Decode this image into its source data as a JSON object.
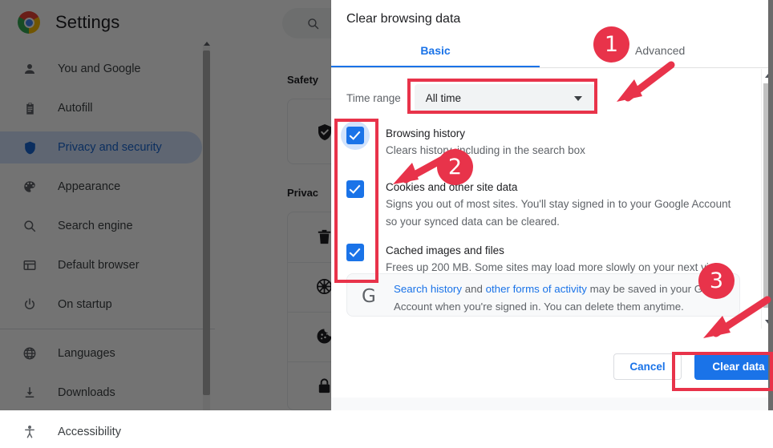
{
  "background": {
    "app_title": "Settings",
    "logo_icon": "chrome-logo-icon",
    "search_icon": "search-icon",
    "sidebar": {
      "items": [
        {
          "label": "You and Google",
          "icon": "person-icon",
          "selected": false
        },
        {
          "label": "Autofill",
          "icon": "clipboard-icon",
          "selected": false
        },
        {
          "label": "Privacy and security",
          "icon": "shield-icon",
          "selected": true
        },
        {
          "label": "Appearance",
          "icon": "palette-icon",
          "selected": false
        },
        {
          "label": "Search engine",
          "icon": "search-icon",
          "selected": false
        },
        {
          "label": "Default browser",
          "icon": "browser-window-icon",
          "selected": false
        },
        {
          "label": "On startup",
          "icon": "power-icon",
          "selected": false
        },
        {
          "label": "Languages",
          "icon": "globe-icon",
          "selected": false
        },
        {
          "label": "Downloads",
          "icon": "download-icon",
          "selected": false
        },
        {
          "label": "Accessibility",
          "icon": "accessibility-icon",
          "selected": false
        }
      ]
    },
    "sections": [
      {
        "heading": "Safety",
        "card_icons": [
          "shield-check-icon"
        ]
      },
      {
        "heading": "Privac",
        "card_icons": [
          "trash-icon",
          "privacy-guide-icon",
          "cookie-icon",
          "lock-icon"
        ]
      }
    ]
  },
  "dialog": {
    "title": "Clear browsing data",
    "tabs": [
      {
        "label": "Basic",
        "active": true
      },
      {
        "label": "Advanced",
        "active": false
      }
    ],
    "time_range": {
      "label": "Time range",
      "value": "All time",
      "caret_icon": "chevron-down-icon"
    },
    "options": [
      {
        "title": "Browsing history",
        "description": "Clears history, including in the search box",
        "checked": true,
        "focused": true
      },
      {
        "title": "Cookies and other site data",
        "description": "Signs you out of most sites. You'll stay signed in to your Google Account so your synced data can be cleared.",
        "checked": true,
        "focused": false
      },
      {
        "title": "Cached images and files",
        "description": "Frees up 200 MB. Some sites may load more slowly on your next visit.",
        "checked": true,
        "focused": false
      }
    ],
    "google_note": {
      "logo": "G",
      "link1": "Search history",
      "mid1": " and ",
      "link2": "other forms of activity",
      "tail": " may be saved in your Google Account when you're signed in. You can delete them anytime."
    },
    "footer": {
      "cancel_label": "Cancel",
      "confirm_label": "Clear data"
    },
    "scrollbar": {
      "up_icon": "scroll-up-arrow-icon",
      "down_icon": "scroll-down-arrow-icon"
    }
  },
  "annotations": {
    "accent_color": "#e8334a",
    "steps": [
      {
        "number": "1",
        "target": "time-range-dropdown"
      },
      {
        "number": "2",
        "target": "data-type-checkboxes"
      },
      {
        "number": "3",
        "target": "clear-data-button"
      }
    ]
  },
  "colors": {
    "brand_blue": "#1a73e8",
    "selected_nav_bg": "#d2e3fc",
    "annotation_red": "#e8334a",
    "overlay": "rgba(0,0,0,0.55)"
  }
}
